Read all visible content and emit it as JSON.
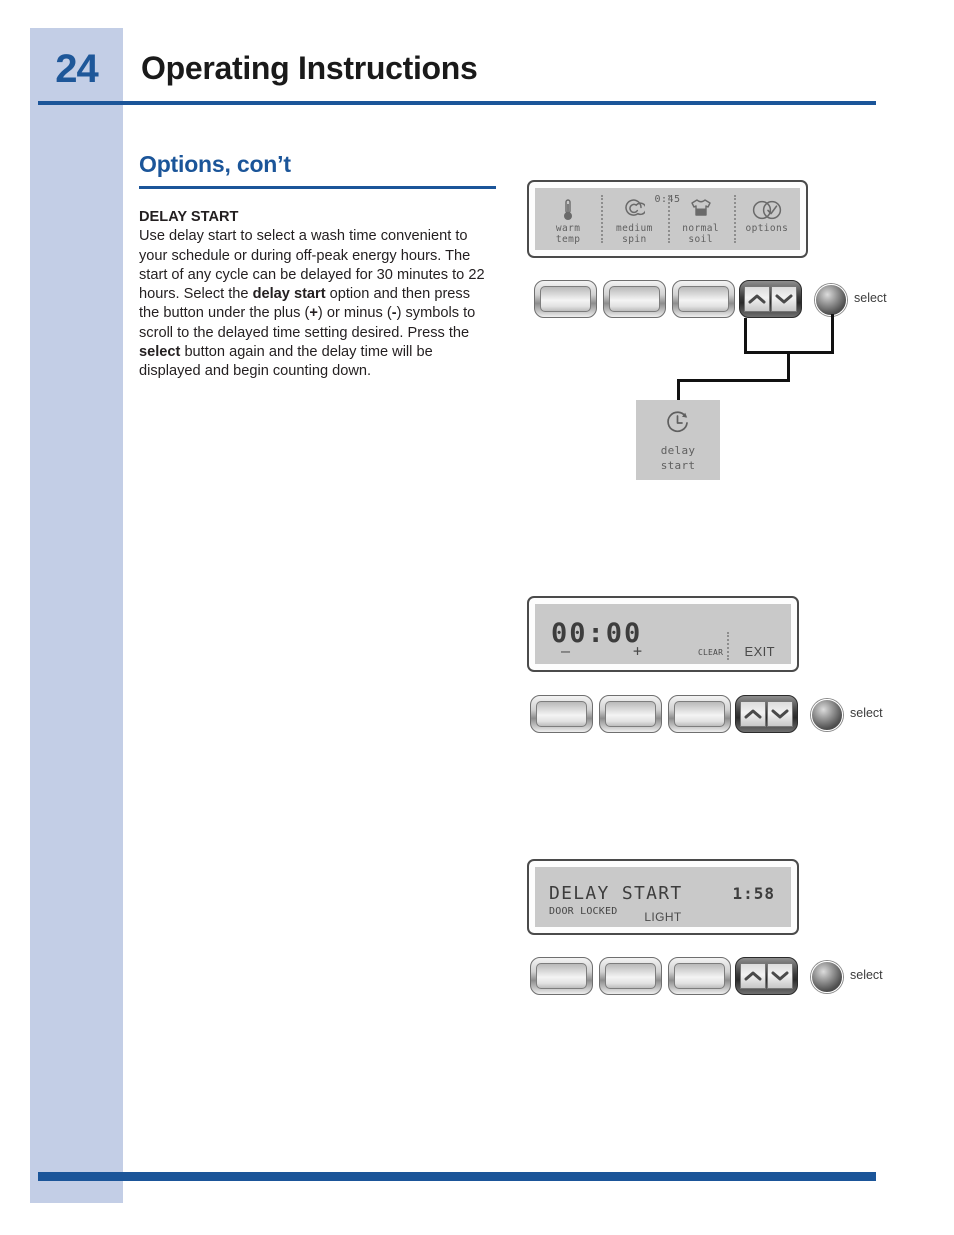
{
  "page": {
    "number": "24",
    "title": "Operating Instructions"
  },
  "section": {
    "heading": "Options, con’t",
    "subheading": "DELAY START",
    "body_part1": "Use delay start to select a wash time convenient to your schedule or during off-peak energy hours. The start of any cycle can be delayed for 30 minutes to 22 hours. Select the ",
    "body_bold1": "delay start",
    "body_part2": " option and then press the button under the plus (",
    "body_bold2": "+",
    "body_part3": ") or minus (",
    "body_bold3": "-",
    "body_part4": ") symbols to scroll to the delayed time setting desired. Press the ",
    "body_bold4": "select",
    "body_part5": " button again and the delay time will be displayed and begin counting down."
  },
  "status_display": {
    "timer": "0:45",
    "cells": [
      {
        "icon": "thermometer-icon",
        "line1": "warm",
        "line2": "temp"
      },
      {
        "icon": "spiral-spin-icon",
        "line1": "medium",
        "line2": "spin"
      },
      {
        "icon": "tshirt-soil-icon",
        "line1": "normal",
        "line2": "soil"
      },
      {
        "icon": "options-circles-icon",
        "line1": "options",
        "line2": ""
      }
    ]
  },
  "clock_display": {
    "digits": "00:00",
    "softkeys": {
      "minus": "–",
      "plus": "+",
      "clear": "CLEAR",
      "exit": "EXIT"
    }
  },
  "running_display": {
    "title": "DELAY START",
    "time": "1:58",
    "status": "DOOR LOCKED",
    "light": "LIGHT"
  },
  "callout": {
    "icon": "clock-delay-icon",
    "line1": "delay",
    "line2": "start"
  },
  "controls": {
    "select_label": "select",
    "up_icon": "chevron-up-icon",
    "down_icon": "chevron-down-icon"
  },
  "colors": {
    "accent_blue": "#1b5599",
    "band_blue": "#c3cee6",
    "lcd_gray": "#c9c9c9",
    "text_dark": "#231f20"
  }
}
